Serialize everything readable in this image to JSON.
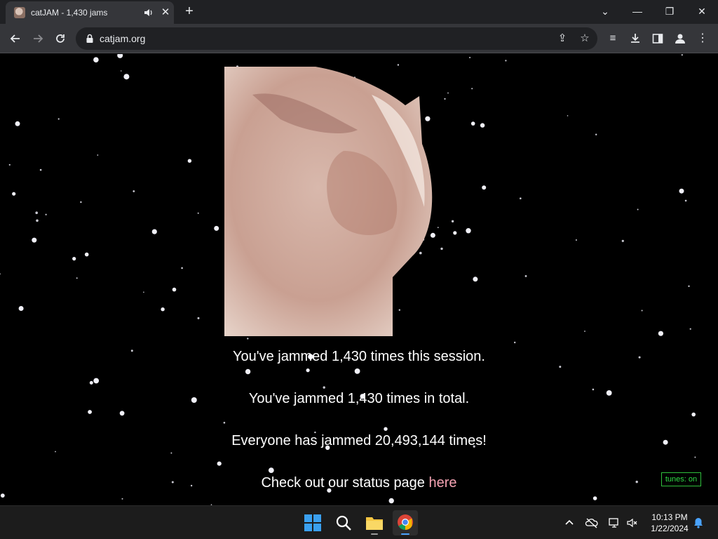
{
  "browser": {
    "tab_title": "catJAM - 1,430 jams",
    "url": "catjam.org"
  },
  "page": {
    "session_text": "You've jammed 1,430 times this session.",
    "total_text": "You've jammed 1,430 times in total.",
    "everyone_text": "Everyone has jammed 20,493,144 times!",
    "status_prefix": "Check out our status page ",
    "status_link": "here",
    "tunes_label": "tunes: on"
  },
  "taskbar": {
    "time": "10:13 PM",
    "date": "1/22/2024"
  },
  "colors": {
    "background": "#000000",
    "link": "#f5a3b3",
    "tunes": "#2fdd45"
  }
}
